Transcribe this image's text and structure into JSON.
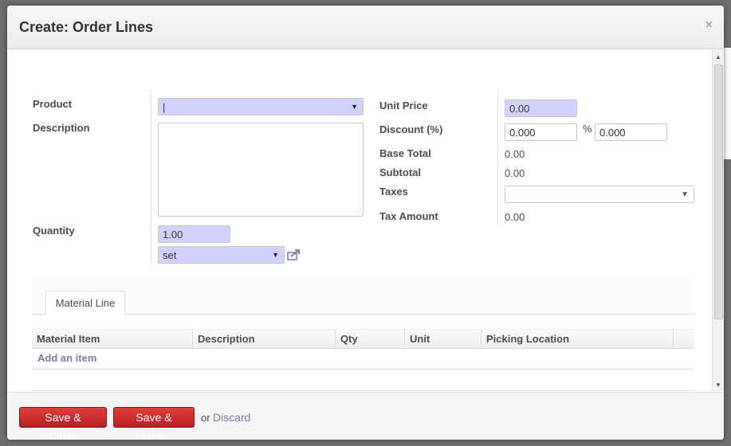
{
  "dialog": {
    "title": "Create: Order Lines",
    "close_label": "×"
  },
  "form": {
    "product": {
      "label": "Product",
      "value": "|"
    },
    "description": {
      "label": "Description",
      "value": ""
    },
    "quantity": {
      "label": "Quantity",
      "value": "1.00",
      "uom": "set"
    },
    "unit_price": {
      "label": "Unit Price",
      "value": "0.00"
    },
    "discount": {
      "label": "Discount (%)",
      "value": "0.000",
      "percent_sign": "%",
      "value2": "0.000"
    },
    "base_total": {
      "label": "Base Total",
      "value": "0.00"
    },
    "subtotal": {
      "label": "Subtotal",
      "value": "0.00"
    },
    "taxes": {
      "label": "Taxes",
      "value": ""
    },
    "tax_amount": {
      "label": "Tax Amount",
      "value": "0.00"
    }
  },
  "notebook": {
    "tabs": [
      {
        "label": "Material Line",
        "active": true
      }
    ],
    "columns": [
      "Material Item",
      "Description",
      "Qty",
      "Unit",
      "Picking Location"
    ],
    "add_item_label": "Add an item"
  },
  "footer": {
    "save_close_label": "Save & Close",
    "save_new_label": "Save & New",
    "or_label": "or",
    "discard_label": "Discard"
  },
  "colors": {
    "required_field": "#d2d2ff",
    "primary_button": "#c92a2a",
    "link": "#7c7bad"
  },
  "icons": {
    "dropdown": "caret-down-icon",
    "external": "external-link-icon",
    "close": "close-icon"
  }
}
